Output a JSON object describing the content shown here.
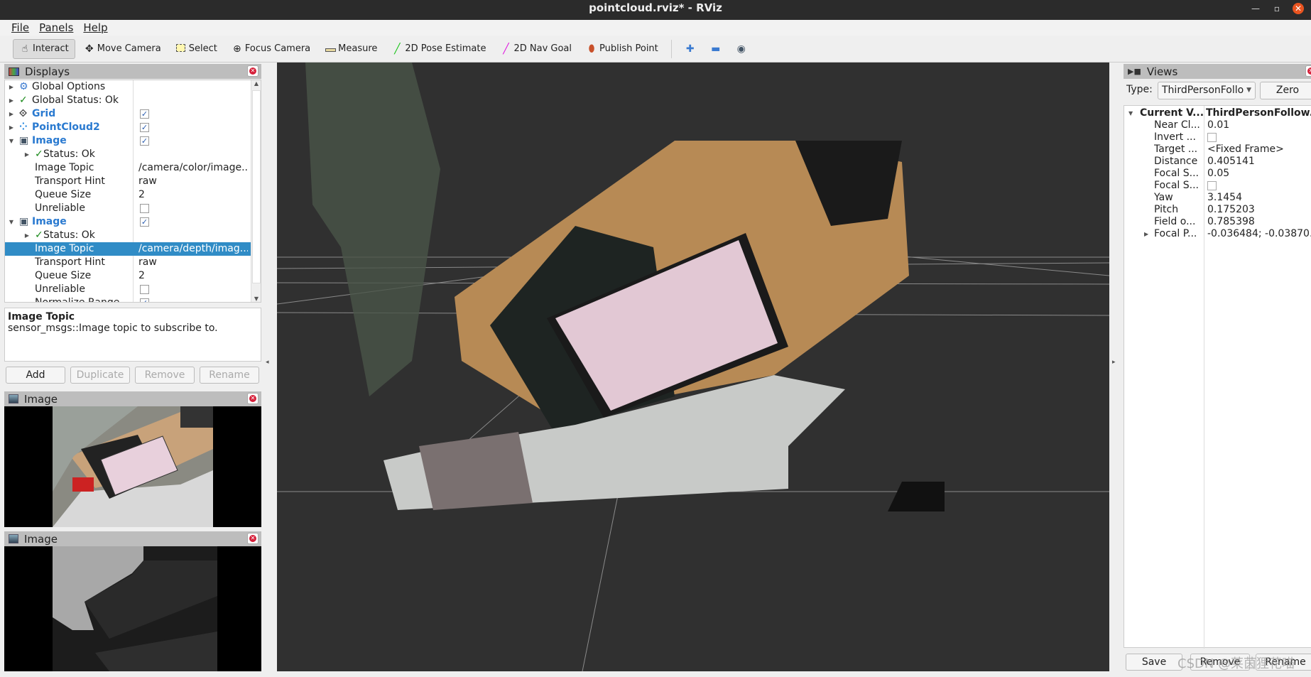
{
  "window": {
    "title": "pointcloud.rviz* - RViz"
  },
  "menu": [
    "File",
    "Panels",
    "Help"
  ],
  "toolbar": {
    "tools": [
      {
        "label": "Interact",
        "icon": "hand-icon",
        "active": true
      },
      {
        "label": "Move Camera",
        "icon": "move-camera-icon"
      },
      {
        "label": "Select",
        "icon": "select-icon"
      },
      {
        "label": "Focus Camera",
        "icon": "focus-camera-icon"
      },
      {
        "label": "Measure",
        "icon": "ruler-icon"
      },
      {
        "label": "2D Pose Estimate",
        "icon": "green-arrow-icon"
      },
      {
        "label": "2D Nav Goal",
        "icon": "magenta-arrow-icon"
      },
      {
        "label": "Publish Point",
        "icon": "map-pin-icon"
      }
    ]
  },
  "displays": {
    "title": "Displays",
    "rows": [
      {
        "label": "Global Options",
        "value": "",
        "icon": "gear-icon"
      },
      {
        "label": "Global Status: Ok",
        "value": "",
        "icon": "check-icon"
      },
      {
        "label": "Grid",
        "checked": true,
        "icon": "grid-icon"
      },
      {
        "label": "PointCloud2",
        "checked": true,
        "icon": "pointcloud-icon"
      },
      {
        "label": "Image",
        "checked": true,
        "icon": "image-icon"
      },
      {
        "label": "Status: Ok",
        "icon": "check-icon"
      },
      {
        "label": "Image Topic",
        "value": "/camera/color/image..."
      },
      {
        "label": "Transport Hint",
        "value": "raw"
      },
      {
        "label": "Queue Size",
        "value": "2"
      },
      {
        "label": "Unreliable",
        "checked": false
      },
      {
        "label": "Image",
        "checked": true,
        "icon": "image-icon"
      },
      {
        "label": "Status: Ok",
        "icon": "check-icon"
      },
      {
        "label": "Image Topic",
        "value": "/camera/depth/imag...",
        "selected": true
      },
      {
        "label": "Transport Hint",
        "value": "raw"
      },
      {
        "label": "Queue Size",
        "value": "2"
      },
      {
        "label": "Unreliable",
        "checked": false
      },
      {
        "label": "Normalize Range",
        "checked": true
      }
    ],
    "description": {
      "title": "Image Topic",
      "text": "sensor_msgs::Image topic to subscribe to."
    },
    "buttons": {
      "add": "Add",
      "duplicate": "Duplicate",
      "remove": "Remove",
      "rename": "Rename"
    }
  },
  "image_panels": [
    {
      "title": "Image"
    },
    {
      "title": "Image"
    }
  ],
  "views": {
    "title": "Views",
    "type_label": "Type:",
    "type_value": "ThirdPersonFollo",
    "zero": "Zero",
    "header": {
      "k": "Current V...",
      "v": "ThirdPersonFollow..."
    },
    "rows": [
      {
        "k": "Near Cl...",
        "v": "0.01"
      },
      {
        "k": "Invert ...",
        "checkbox": true
      },
      {
        "k": "Target ...",
        "v": "<Fixed Frame>"
      },
      {
        "k": "Distance",
        "v": "0.405141"
      },
      {
        "k": "Focal S...",
        "v": "0.05"
      },
      {
        "k": "Focal S...",
        "checkbox": true
      },
      {
        "k": "Yaw",
        "v": "3.1454"
      },
      {
        "k": "Pitch",
        "v": "0.175203"
      },
      {
        "k": "Field o...",
        "v": "0.785398"
      },
      {
        "k": "Focal P...",
        "v": "-0.036484; -0.03870...",
        "expandable": true
      }
    ],
    "buttons": {
      "save": "Save",
      "remove": "Remove",
      "rename": "Rename"
    }
  },
  "watermark": "CSDN @莱茵狸花喵",
  "colors": {
    "selection": "#308cc6",
    "view_bg": "#303030",
    "display_name": "#2a7ad0"
  }
}
